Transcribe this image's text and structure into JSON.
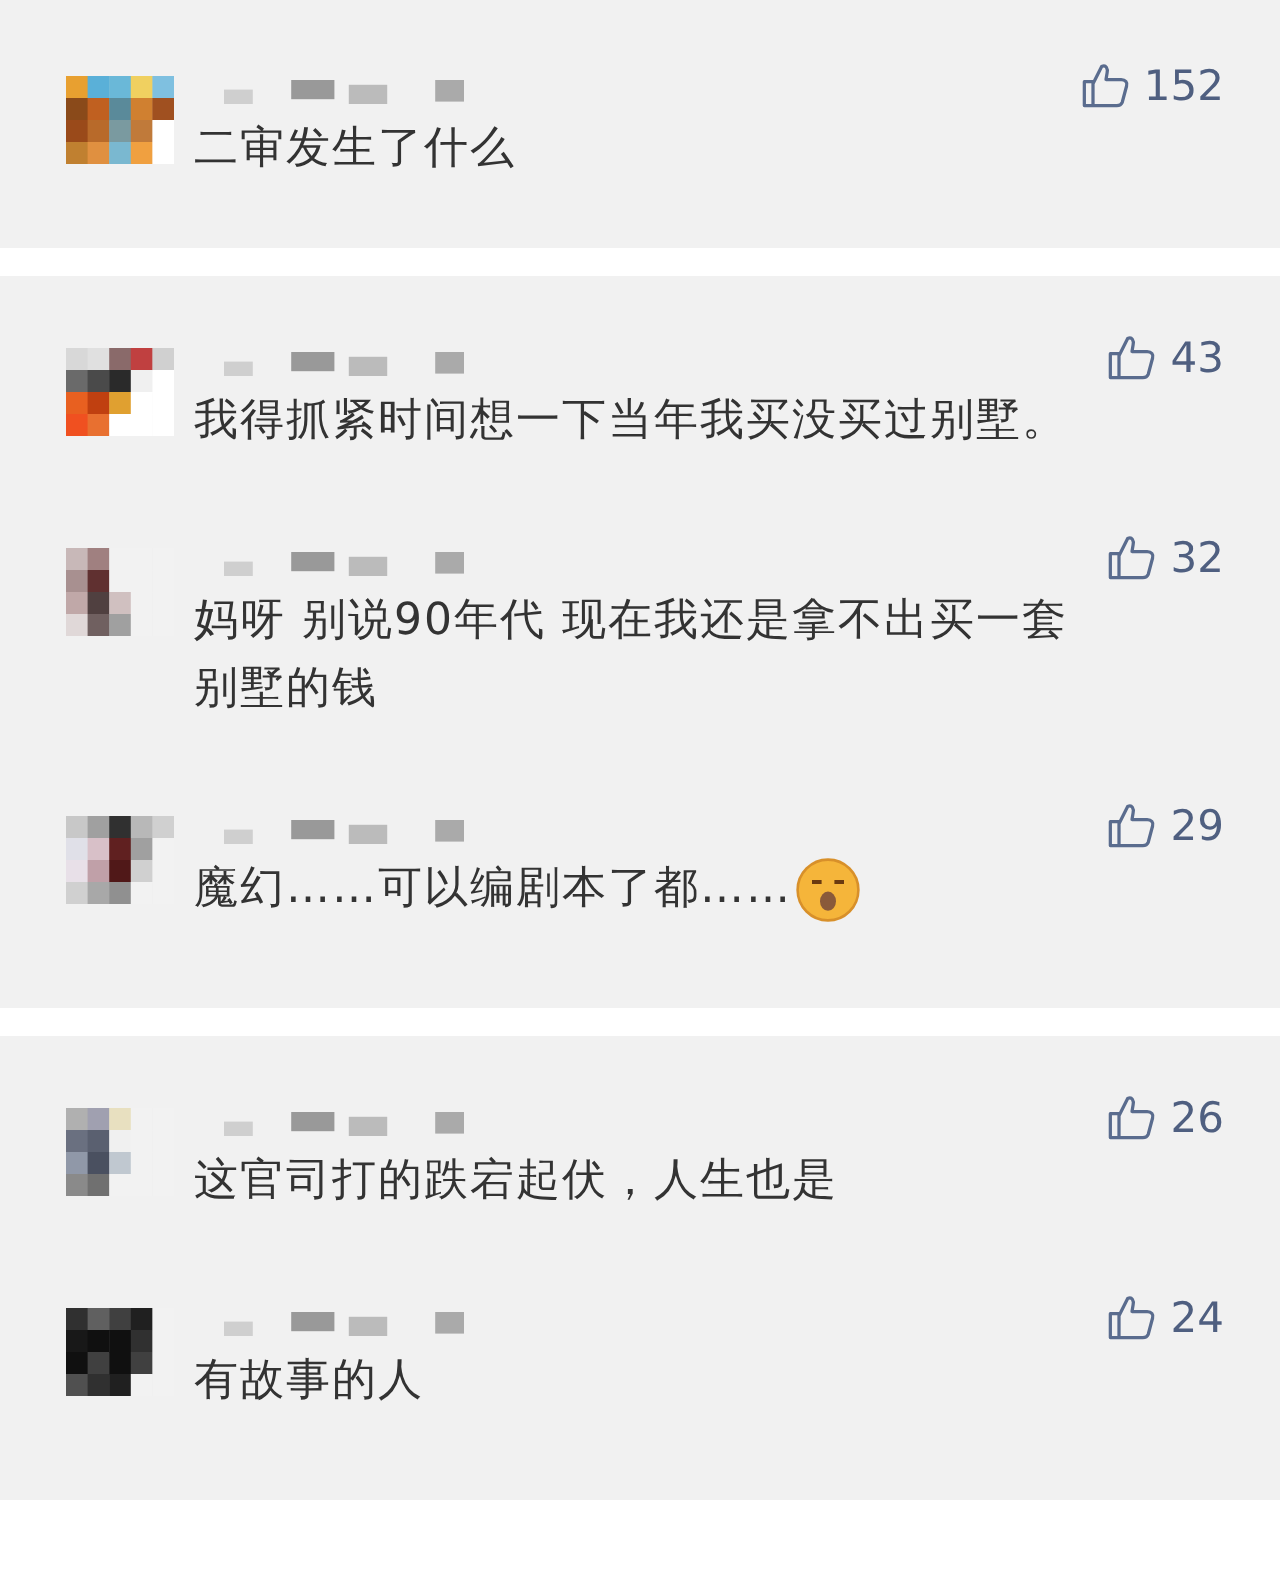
{
  "cards": [
    {
      "comments": [
        {
          "likes": "152",
          "text": "二审发生了什么",
          "emoji": false
        }
      ]
    },
    {
      "comments": [
        {
          "likes": "43",
          "text": "我得抓紧时间想一下当年我买没买过别墅。",
          "emoji": false
        },
        {
          "likes": "32",
          "text": "妈呀 别说90年代 现在我还是拿不出买一套别墅的钱",
          "emoji": false
        },
        {
          "likes": "29",
          "text": "魔幻……可以编剧本了都……",
          "emoji": true
        }
      ]
    },
    {
      "comments": [
        {
          "likes": "26",
          "text": "这官司打的跌宕起伏，人生也是",
          "emoji": false
        },
        {
          "likes": "24",
          "text": "有故事的人",
          "emoji": false
        }
      ]
    }
  ]
}
